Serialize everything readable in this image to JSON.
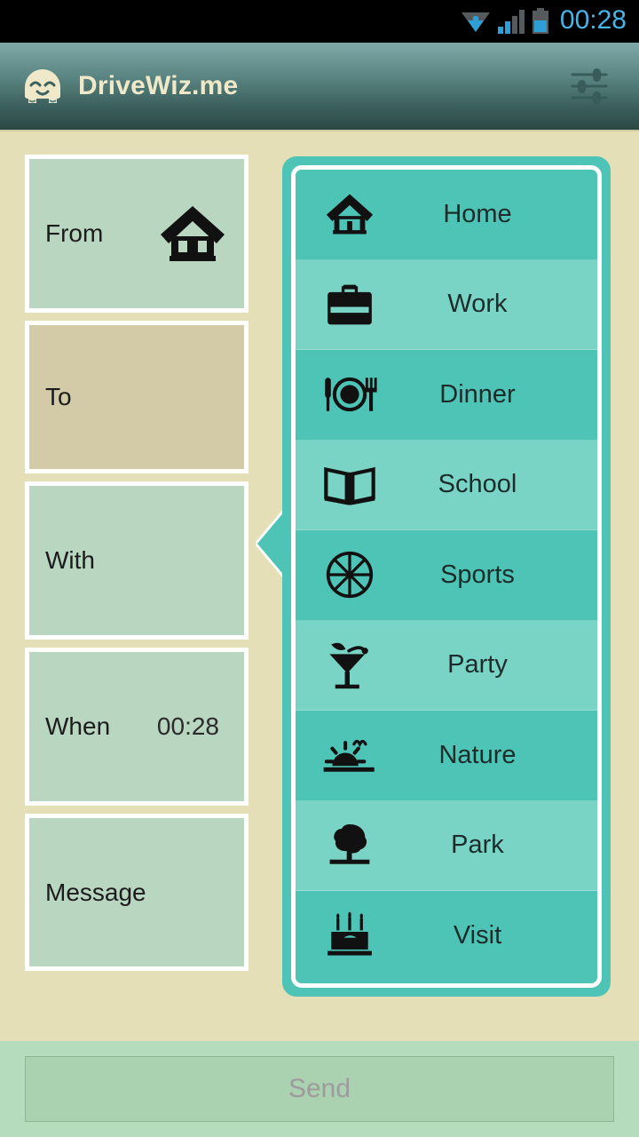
{
  "statusbar": {
    "time": "00:28",
    "icons": [
      "wifi-icon",
      "signal-icon",
      "battery-icon"
    ]
  },
  "appbar": {
    "title": "DriveWiz.me",
    "logo_icon": "drivewiz-car-face-logo",
    "settings_icon": "sliders-settings-icon"
  },
  "form": {
    "fields": [
      {
        "label": "From",
        "value": "",
        "icon": "home-icon",
        "selected": false
      },
      {
        "label": "To",
        "value": "",
        "icon": "",
        "selected": true
      },
      {
        "label": "With",
        "value": "",
        "icon": "",
        "selected": false
      },
      {
        "label": "When",
        "value": "00:28",
        "icon": "",
        "selected": false
      },
      {
        "label": "Message",
        "value": "",
        "icon": "",
        "selected": false
      }
    ]
  },
  "categories": {
    "items": [
      {
        "label": "Home",
        "icon": "home-icon"
      },
      {
        "label": "Work",
        "icon": "briefcase-icon"
      },
      {
        "label": "Dinner",
        "icon": "restaurant-icon"
      },
      {
        "label": "School",
        "icon": "open-book-icon"
      },
      {
        "label": "Sports",
        "icon": "basketball-icon"
      },
      {
        "label": "Party",
        "icon": "cocktail-icon"
      },
      {
        "label": "Nature",
        "icon": "sunrise-icon"
      },
      {
        "label": "Park",
        "icon": "tree-icon"
      },
      {
        "label": "Visit",
        "icon": "birthday-cake-icon"
      }
    ]
  },
  "bottom": {
    "send_label": "Send"
  },
  "colors": {
    "background": "#e4dfb6",
    "accent_teal": "#4ec4b6",
    "accent_teal_light": "#7ad4c6",
    "field_green": "#b9d6c1",
    "field_selected": "#d3caa8",
    "appbar_top": "#7fa9a8",
    "appbar_bottom": "#2b4744",
    "statusbar_clock": "#45b4e8",
    "bottombar": "#b5dcbc",
    "send_button": "#aad1b0",
    "send_text": "#9d9b9b"
  }
}
